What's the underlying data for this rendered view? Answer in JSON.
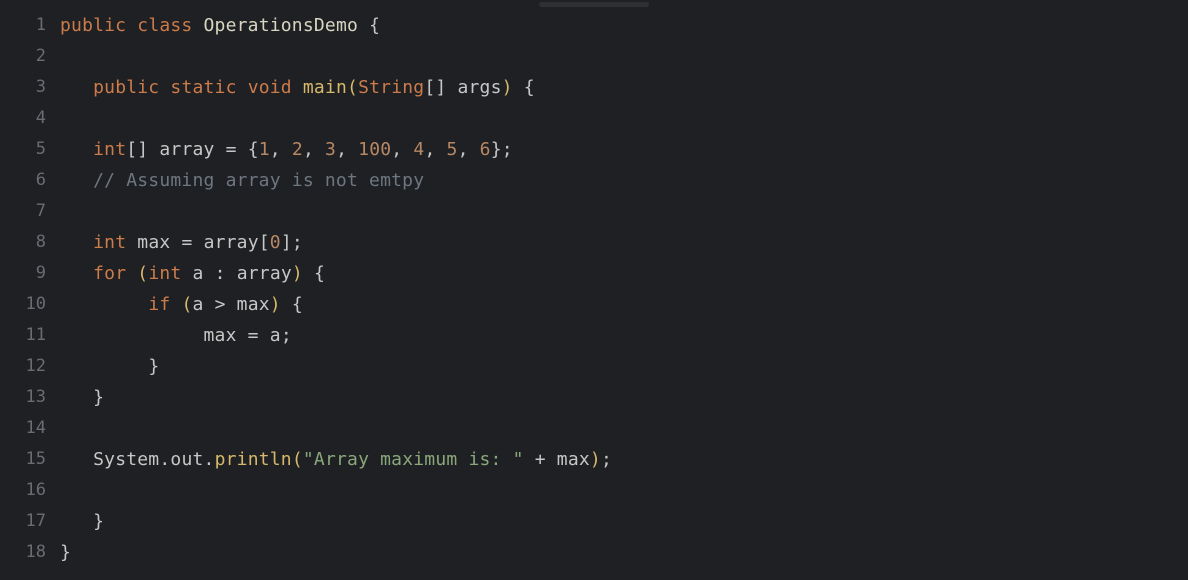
{
  "code": {
    "totalLines": 18,
    "lines": [
      {
        "num": 1,
        "indent": 0,
        "tokens": [
          [
            "keyword",
            "public"
          ],
          [
            "sp",
            " "
          ],
          [
            "keyword",
            "class"
          ],
          [
            "sp",
            " "
          ],
          [
            "classname",
            "OperationsDemo"
          ],
          [
            "sp",
            " "
          ],
          [
            "brace",
            "{"
          ]
        ]
      },
      {
        "num": 2,
        "indent": 0,
        "tokens": []
      },
      {
        "num": 3,
        "indent": 1,
        "tokens": [
          [
            "keyword",
            "public"
          ],
          [
            "sp",
            " "
          ],
          [
            "keyword",
            "static"
          ],
          [
            "sp",
            " "
          ],
          [
            "type",
            "void"
          ],
          [
            "sp",
            " "
          ],
          [
            "method",
            "main"
          ],
          [
            "paren",
            "("
          ],
          [
            "type",
            "String"
          ],
          [
            "brack",
            "[]"
          ],
          [
            "sp",
            " "
          ],
          [
            "ident",
            "args"
          ],
          [
            "paren",
            ")"
          ],
          [
            "sp",
            " "
          ],
          [
            "brace",
            "{"
          ]
        ]
      },
      {
        "num": 4,
        "indent": 0,
        "tokens": []
      },
      {
        "num": 5,
        "indent": 1,
        "tokens": [
          [
            "type",
            "int"
          ],
          [
            "brack",
            "[]"
          ],
          [
            "sp",
            " "
          ],
          [
            "ident",
            "array"
          ],
          [
            "sp",
            " "
          ],
          [
            "op",
            "="
          ],
          [
            "sp",
            " "
          ],
          [
            "brace",
            "{"
          ],
          [
            "number",
            "1"
          ],
          [
            "punct",
            ","
          ],
          [
            "sp",
            " "
          ],
          [
            "number",
            "2"
          ],
          [
            "punct",
            ","
          ],
          [
            "sp",
            " "
          ],
          [
            "number",
            "3"
          ],
          [
            "punct",
            ","
          ],
          [
            "sp",
            " "
          ],
          [
            "number",
            "100"
          ],
          [
            "punct",
            ","
          ],
          [
            "sp",
            " "
          ],
          [
            "number",
            "4"
          ],
          [
            "punct",
            ","
          ],
          [
            "sp",
            " "
          ],
          [
            "number",
            "5"
          ],
          [
            "punct",
            ","
          ],
          [
            "sp",
            " "
          ],
          [
            "number",
            "6"
          ],
          [
            "brace",
            "}"
          ],
          [
            "punct",
            ";"
          ]
        ]
      },
      {
        "num": 6,
        "indent": 1,
        "tokens": [
          [
            "comment",
            "// Assuming array is not emtpy"
          ]
        ]
      },
      {
        "num": 7,
        "indent": 0,
        "tokens": []
      },
      {
        "num": 8,
        "indent": 1,
        "tokens": [
          [
            "type",
            "int"
          ],
          [
            "sp",
            " "
          ],
          [
            "ident",
            "max"
          ],
          [
            "sp",
            " "
          ],
          [
            "op",
            "="
          ],
          [
            "sp",
            " "
          ],
          [
            "ident",
            "array"
          ],
          [
            "brack",
            "["
          ],
          [
            "number",
            "0"
          ],
          [
            "brack",
            "]"
          ],
          [
            "punct",
            ";"
          ]
        ]
      },
      {
        "num": 9,
        "indent": 1,
        "tokens": [
          [
            "keyword",
            "for"
          ],
          [
            "sp",
            " "
          ],
          [
            "paren",
            "("
          ],
          [
            "type",
            "int"
          ],
          [
            "sp",
            " "
          ],
          [
            "ident",
            "a"
          ],
          [
            "sp",
            " "
          ],
          [
            "op",
            ":"
          ],
          [
            "sp",
            " "
          ],
          [
            "ident",
            "array"
          ],
          [
            "paren",
            ")"
          ],
          [
            "sp",
            " "
          ],
          [
            "brace",
            "{"
          ]
        ]
      },
      {
        "num": 10,
        "indent": 2,
        "tokens": [
          [
            "sp",
            "  "
          ],
          [
            "keyword",
            "if"
          ],
          [
            "sp",
            " "
          ],
          [
            "paren",
            "("
          ],
          [
            "ident",
            "a"
          ],
          [
            "sp",
            " "
          ],
          [
            "op",
            ">"
          ],
          [
            "sp",
            " "
          ],
          [
            "ident",
            "max"
          ],
          [
            "paren",
            ")"
          ],
          [
            "sp",
            " "
          ],
          [
            "brace",
            "{"
          ]
        ]
      },
      {
        "num": 11,
        "indent": 2,
        "tokens": [
          [
            "sp",
            "       "
          ],
          [
            "ident",
            "max"
          ],
          [
            "sp",
            " "
          ],
          [
            "op",
            "="
          ],
          [
            "sp",
            " "
          ],
          [
            "ident",
            "a"
          ],
          [
            "punct",
            ";"
          ]
        ]
      },
      {
        "num": 12,
        "indent": 2,
        "tokens": [
          [
            "sp",
            "  "
          ],
          [
            "brace",
            "}"
          ]
        ]
      },
      {
        "num": 13,
        "indent": 1,
        "tokens": [
          [
            "brace",
            "}"
          ]
        ]
      },
      {
        "num": 14,
        "indent": 0,
        "tokens": []
      },
      {
        "num": 15,
        "indent": 1,
        "tokens": [
          [
            "ident",
            "System"
          ],
          [
            "punct",
            "."
          ],
          [
            "ident",
            "out"
          ],
          [
            "punct",
            "."
          ],
          [
            "call",
            "println"
          ],
          [
            "paren",
            "("
          ],
          [
            "string",
            "\"Array maximum is: \""
          ],
          [
            "sp",
            " "
          ],
          [
            "op",
            "+"
          ],
          [
            "sp",
            " "
          ],
          [
            "ident",
            "max"
          ],
          [
            "paren",
            ")"
          ],
          [
            "punct",
            ";"
          ]
        ]
      },
      {
        "num": 16,
        "indent": 0,
        "tokens": []
      },
      {
        "num": 17,
        "indent": 1,
        "tokens": [
          [
            "brace",
            "}"
          ]
        ]
      },
      {
        "num": 18,
        "indent": 0,
        "tokens": [
          [
            "brace",
            "}"
          ]
        ]
      }
    ]
  },
  "indentUnit": "   "
}
